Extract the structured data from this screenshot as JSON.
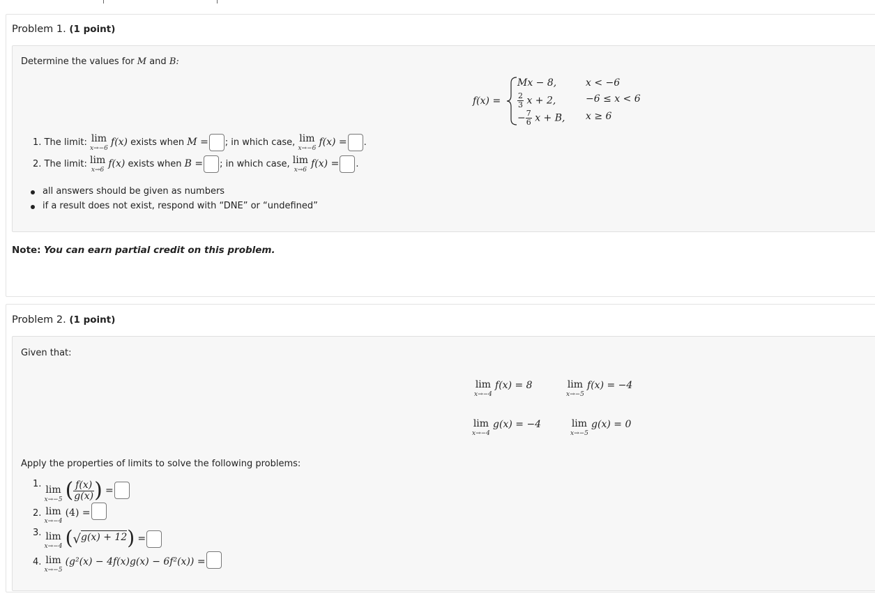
{
  "problem1": {
    "title": "Problem 1.",
    "points": "(1 point)",
    "intro": "Determine the values for",
    "intro_var1": "M",
    "intro_and": "and",
    "intro_var2": "B:",
    "fx_label": "f(x) =",
    "cases": [
      {
        "expr": "Mx − 8,",
        "cond": "x < −6"
      },
      {
        "expr_num": "2",
        "expr_den": "3",
        "expr_rest": "x + 2,",
        "cond": "−6 ≤ x < 6"
      },
      {
        "expr_prefix": "−",
        "expr_num": "7",
        "expr_den": "6",
        "expr_rest": "x + B,",
        "cond": "x ≥ 6"
      }
    ],
    "items": [
      {
        "num": "1.",
        "text1": "The limit:",
        "lim_sub": "x→−6",
        "fx": "f(x)",
        "text2": "exists when",
        "var": "M =",
        "text3": "; in which case,",
        "lim2_sub": "x→−6",
        "fx2": "f(x) ="
      },
      {
        "num": "2.",
        "text1": "The limit:",
        "lim_sub": "x→6",
        "fx": "f(x)",
        "text2": "exists when",
        "var": "B =",
        "text3": "; in which case,",
        "lim2_sub": "x→6",
        "fx2": "f(x) ="
      }
    ],
    "bullets": [
      "all answers should be given as numbers",
      "if a result does not exist, respond with “DNE” or “undefined”"
    ],
    "note_label": "Note:",
    "note_text": "You can earn partial credit on this problem."
  },
  "problem2": {
    "title": "Problem 2.",
    "points": "(1 point)",
    "given": "Given that:",
    "limits": [
      {
        "sub": "x→−4",
        "expr": "f(x) = 8"
      },
      {
        "sub": "x→−5",
        "expr": "f(x) = −4"
      },
      {
        "sub": "x→−4",
        "expr": "g(x) = −4"
      },
      {
        "sub": "x→−5",
        "expr": "g(x) = 0"
      }
    ],
    "apply": "Apply the properties of limits to solve the following problems:",
    "items": [
      {
        "num": "1.",
        "sub": "x→−5",
        "num_expr": "f(x)",
        "den_expr": "g(x)"
      },
      {
        "num": "2.",
        "sub": "x→−4",
        "expr": "(4) ="
      },
      {
        "num": "3.",
        "sub": "x→−4",
        "expr": "g(x) + 12"
      },
      {
        "num": "4.",
        "sub": "x→−5",
        "expr": "(g²(x) − 4f(x)g(x) − 6f²(x)) ="
      }
    ],
    "lim_word": "lim"
  }
}
